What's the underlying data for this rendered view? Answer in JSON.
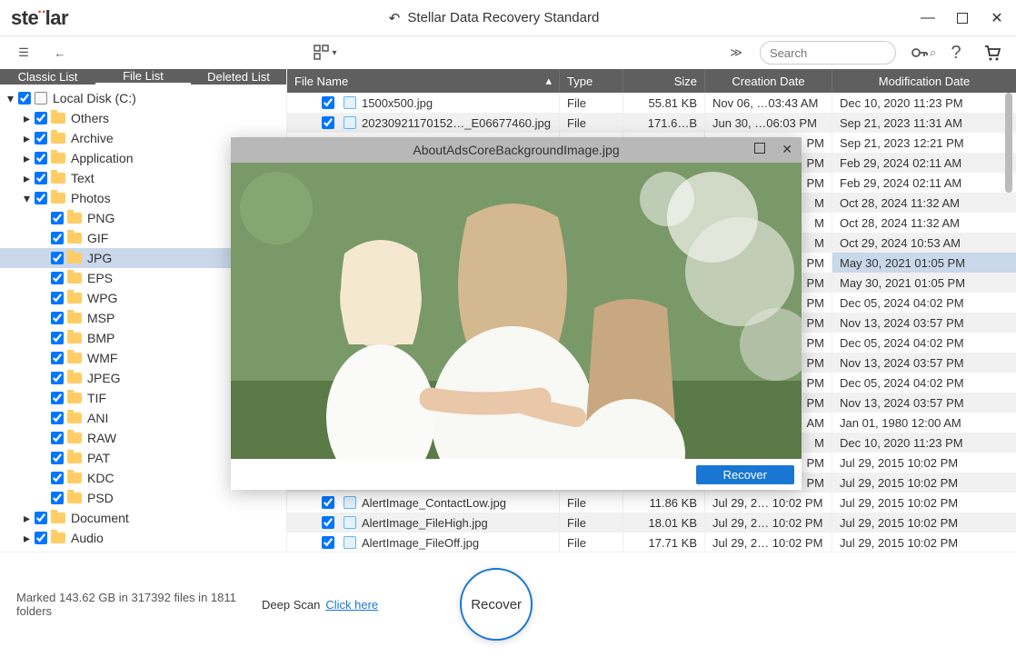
{
  "window": {
    "title": "Stellar Data Recovery Standard",
    "logo": "stellar"
  },
  "toolbar": {
    "search_placeholder": "Search"
  },
  "tabs": {
    "classic": "Classic List",
    "file": "File List",
    "deleted": "Deleted List"
  },
  "tree": {
    "root": "Local Disk (C:)",
    "items": [
      {
        "label": "Others",
        "depth": 1,
        "caret": "▸"
      },
      {
        "label": "Archive",
        "depth": 1,
        "caret": "▸"
      },
      {
        "label": "Application",
        "depth": 1,
        "caret": "▸"
      },
      {
        "label": "Text",
        "depth": 1,
        "caret": "▸"
      },
      {
        "label": "Photos",
        "depth": 1,
        "caret": "▾"
      },
      {
        "label": "PNG",
        "depth": 2,
        "caret": ""
      },
      {
        "label": "GIF",
        "depth": 2,
        "caret": ""
      },
      {
        "label": "JPG",
        "depth": 2,
        "caret": "",
        "selected": true
      },
      {
        "label": "EPS",
        "depth": 2,
        "caret": ""
      },
      {
        "label": "WPG",
        "depth": 2,
        "caret": ""
      },
      {
        "label": "MSP",
        "depth": 2,
        "caret": ""
      },
      {
        "label": "BMP",
        "depth": 2,
        "caret": ""
      },
      {
        "label": "WMF",
        "depth": 2,
        "caret": ""
      },
      {
        "label": "JPEG",
        "depth": 2,
        "caret": ""
      },
      {
        "label": "TIF",
        "depth": 2,
        "caret": ""
      },
      {
        "label": "ANI",
        "depth": 2,
        "caret": ""
      },
      {
        "label": "RAW",
        "depth": 2,
        "caret": ""
      },
      {
        "label": "PAT",
        "depth": 2,
        "caret": ""
      },
      {
        "label": "KDC",
        "depth": 2,
        "caret": ""
      },
      {
        "label": "PSD",
        "depth": 2,
        "caret": ""
      },
      {
        "label": "Document",
        "depth": 1,
        "caret": "▸"
      },
      {
        "label": "Audio",
        "depth": 1,
        "caret": "▸"
      }
    ]
  },
  "columns": {
    "name": "File Name",
    "type": "Type",
    "size": "Size",
    "cdate": "Creation Date",
    "mdate": "Modification Date"
  },
  "files": [
    {
      "name": "1500x500.jpg",
      "type": "File",
      "size": "55.81 KB",
      "cdate": "Nov 06, …03:43 AM",
      "mdate": "Dec 10, 2020 11:23 PM"
    },
    {
      "name": "20230921170152…_E06677460.jpg",
      "type": "File",
      "size": "171.6…B",
      "cdate": "Jun 30, …06:03 PM",
      "mdate": "Sep 21, 2023 11:31 AM"
    },
    {
      "name": "",
      "type": "",
      "size": "",
      "cdate": "PM",
      "cdateR": true,
      "mdate": "Sep 21, 2023 12:21 PM"
    },
    {
      "name": "",
      "type": "",
      "size": "",
      "cdate": "PM",
      "cdateR": true,
      "mdate": "Feb 29, 2024 02:11 AM"
    },
    {
      "name": "",
      "type": "",
      "size": "",
      "cdate": "PM",
      "cdateR": true,
      "mdate": "Feb 29, 2024 02:11 AM"
    },
    {
      "name": "",
      "type": "",
      "size": "",
      "cdate": "M",
      "cdateR": true,
      "mdate": "Oct 28, 2024 11:32 AM"
    },
    {
      "name": "",
      "type": "",
      "size": "",
      "cdate": "M",
      "cdateR": true,
      "mdate": "Oct 28, 2024 11:32 AM"
    },
    {
      "name": "",
      "type": "",
      "size": "",
      "cdate": "M",
      "cdateR": true,
      "mdate": "Oct 29, 2024 10:53 AM"
    },
    {
      "name": "",
      "type": "",
      "size": "",
      "cdate": "PM",
      "cdateR": true,
      "mdate": "May 30, 2021 01:05 PM",
      "selected": true
    },
    {
      "name": "",
      "type": "",
      "size": "",
      "cdate": "PM",
      "cdateR": true,
      "mdate": "May 30, 2021 01:05 PM"
    },
    {
      "name": "",
      "type": "",
      "size": "",
      "cdate": "PM",
      "cdateR": true,
      "mdate": "Dec 05, 2024 04:02 PM"
    },
    {
      "name": "",
      "type": "",
      "size": "",
      "cdate": "PM",
      "cdateR": true,
      "mdate": "Nov 13, 2024 03:57 PM"
    },
    {
      "name": "",
      "type": "",
      "size": "",
      "cdate": "PM",
      "cdateR": true,
      "mdate": "Dec 05, 2024 04:02 PM"
    },
    {
      "name": "",
      "type": "",
      "size": "",
      "cdate": "PM",
      "cdateR": true,
      "mdate": "Nov 13, 2024 03:57 PM"
    },
    {
      "name": "",
      "type": "",
      "size": "",
      "cdate": "PM",
      "cdateR": true,
      "mdate": "Dec 05, 2024 04:02 PM"
    },
    {
      "name": "",
      "type": "",
      "size": "",
      "cdate": "PM",
      "cdateR": true,
      "mdate": "Nov 13, 2024 03:57 PM"
    },
    {
      "name": "",
      "type": "",
      "size": "",
      "cdate": "AM",
      "cdateR": true,
      "mdate": "Jan 01, 1980 12:00 AM"
    },
    {
      "name": "",
      "type": "",
      "size": "",
      "cdate": "M",
      "cdateR": true,
      "mdate": "Dec 10, 2020 11:23 PM"
    },
    {
      "name": "",
      "type": "",
      "size": "",
      "cdate": "PM",
      "cdateR": true,
      "mdate": "Jul 29, 2015 10:02 PM"
    },
    {
      "name": "",
      "type": "",
      "size": "",
      "cdate": "PM",
      "cdateR": true,
      "mdate": "Jul 29, 2015 10:02 PM"
    },
    {
      "name": "AlertImage_ContactLow.jpg",
      "type": "File",
      "size": "11.86 KB",
      "cdate": "Jul 29, 2… 10:02 PM",
      "mdate": "Jul 29, 2015 10:02 PM"
    },
    {
      "name": "AlertImage_FileHigh.jpg",
      "type": "File",
      "size": "18.01 KB",
      "cdate": "Jul 29, 2… 10:02 PM",
      "mdate": "Jul 29, 2015 10:02 PM"
    },
    {
      "name": "AlertImage_FileOff.jpg",
      "type": "File",
      "size": "17.71 KB",
      "cdate": "Jul 29, 2… 10:02 PM",
      "mdate": "Jul 29, 2015 10:02 PM"
    }
  ],
  "preview": {
    "filename": "AboutAdsCoreBackgroundImage.jpg",
    "recover": "Recover"
  },
  "footer": {
    "status": "Marked 143.62 GB in 317392 files in 1811 folders",
    "deepscan_label": "Deep Scan",
    "deepscan_link": "Click here",
    "recover": "Recover"
  }
}
